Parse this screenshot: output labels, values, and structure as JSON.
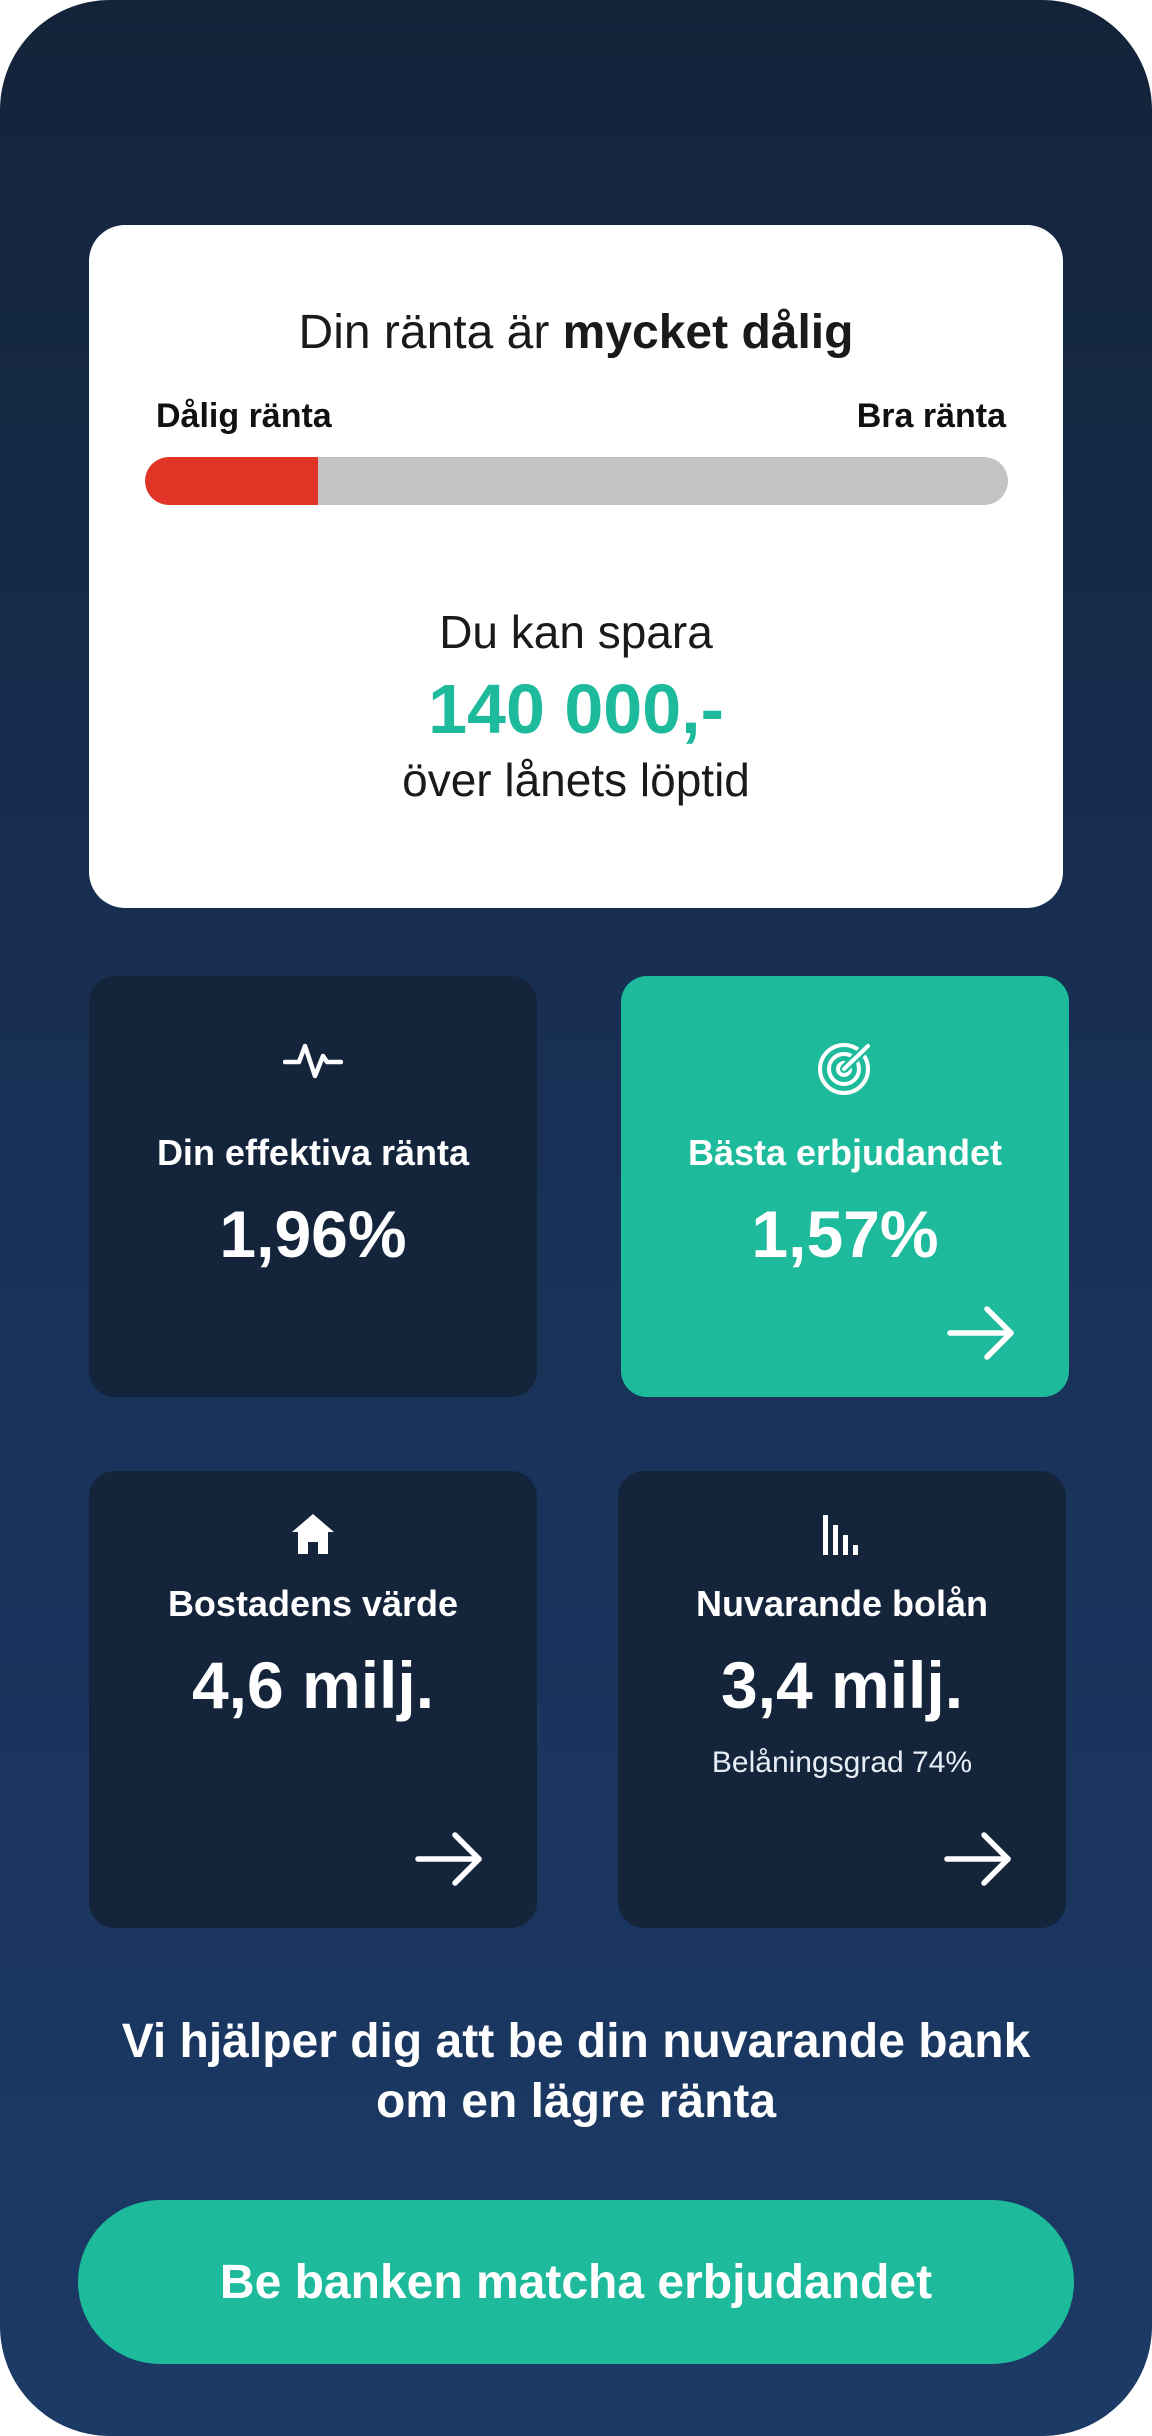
{
  "rating": {
    "title_prefix": "Din ränta är ",
    "title_emphasis": "mycket dålig",
    "scale_left": "Dålig ränta",
    "scale_right": "Bra ränta",
    "level_fraction": 0.2,
    "bad_color": "#e03426",
    "save_label": "Du kan spara",
    "save_amount": "140 000,-",
    "save_sub": "över lånets löptid"
  },
  "tiles": {
    "effective_rate": {
      "icon": "pulse-icon",
      "label": "Din effektiva ränta",
      "value": "1,96%"
    },
    "best_offer": {
      "icon": "target-icon",
      "label": "Bästa erbjudandet",
      "value": "1,57%",
      "arrow": "arrow-right-icon"
    },
    "home_value": {
      "icon": "house-icon",
      "label": "Bostadens värde",
      "value": "4,6 milj.",
      "arrow": "arrow-right-icon"
    },
    "current_loan": {
      "icon": "bar-chart-icon",
      "label": "Nuvarande bolån",
      "value": "3,4 milj.",
      "sub": "Belåningsgrad 74%",
      "arrow": "arrow-right-icon"
    }
  },
  "help_text": "Vi hjälper dig att be din nuvarande bank om en lägre ränta",
  "cta_label": "Be banken matcha erbjudandet",
  "colors": {
    "accent": "#1dba9c",
    "tile_dark": "#14243b",
    "background": "#183055"
  }
}
